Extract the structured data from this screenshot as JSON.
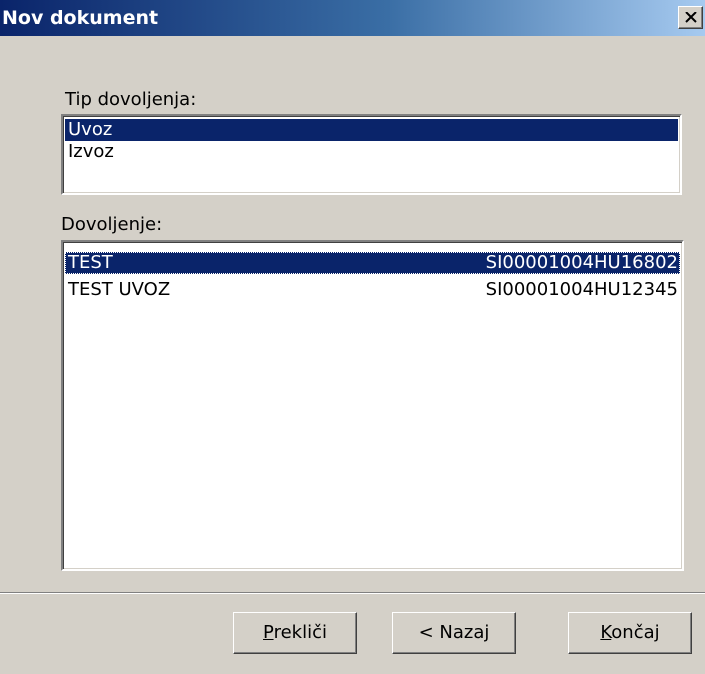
{
  "window": {
    "title": "Nov dokument",
    "close_glyph": "×",
    "close_icon": "close-icon"
  },
  "permit_type": {
    "label": "Tip dovoljenja:",
    "options": [
      {
        "label": "Uvoz",
        "selected": true
      },
      {
        "label": "Izvoz",
        "selected": false
      }
    ]
  },
  "permit": {
    "label": "Dovoljenje:",
    "items": [
      {
        "name": "TEST",
        "code": "SI00001004HU16802",
        "selected": true
      },
      {
        "name": "TEST UVOZ",
        "code": "SI00001004HU12345",
        "selected": false
      }
    ]
  },
  "buttons": {
    "cancel": {
      "mnemonic": "P",
      "rest": "rekliči"
    },
    "back": {
      "label": "< Nazaj"
    },
    "finish": {
      "mnemonic": "K",
      "rest": "ončaj"
    }
  },
  "colors": {
    "selection": "#0a246a",
    "title_gradient_start": "#0a246a",
    "title_gradient_end": "#a6caf0",
    "dialog_face": "#d4d0c8"
  }
}
